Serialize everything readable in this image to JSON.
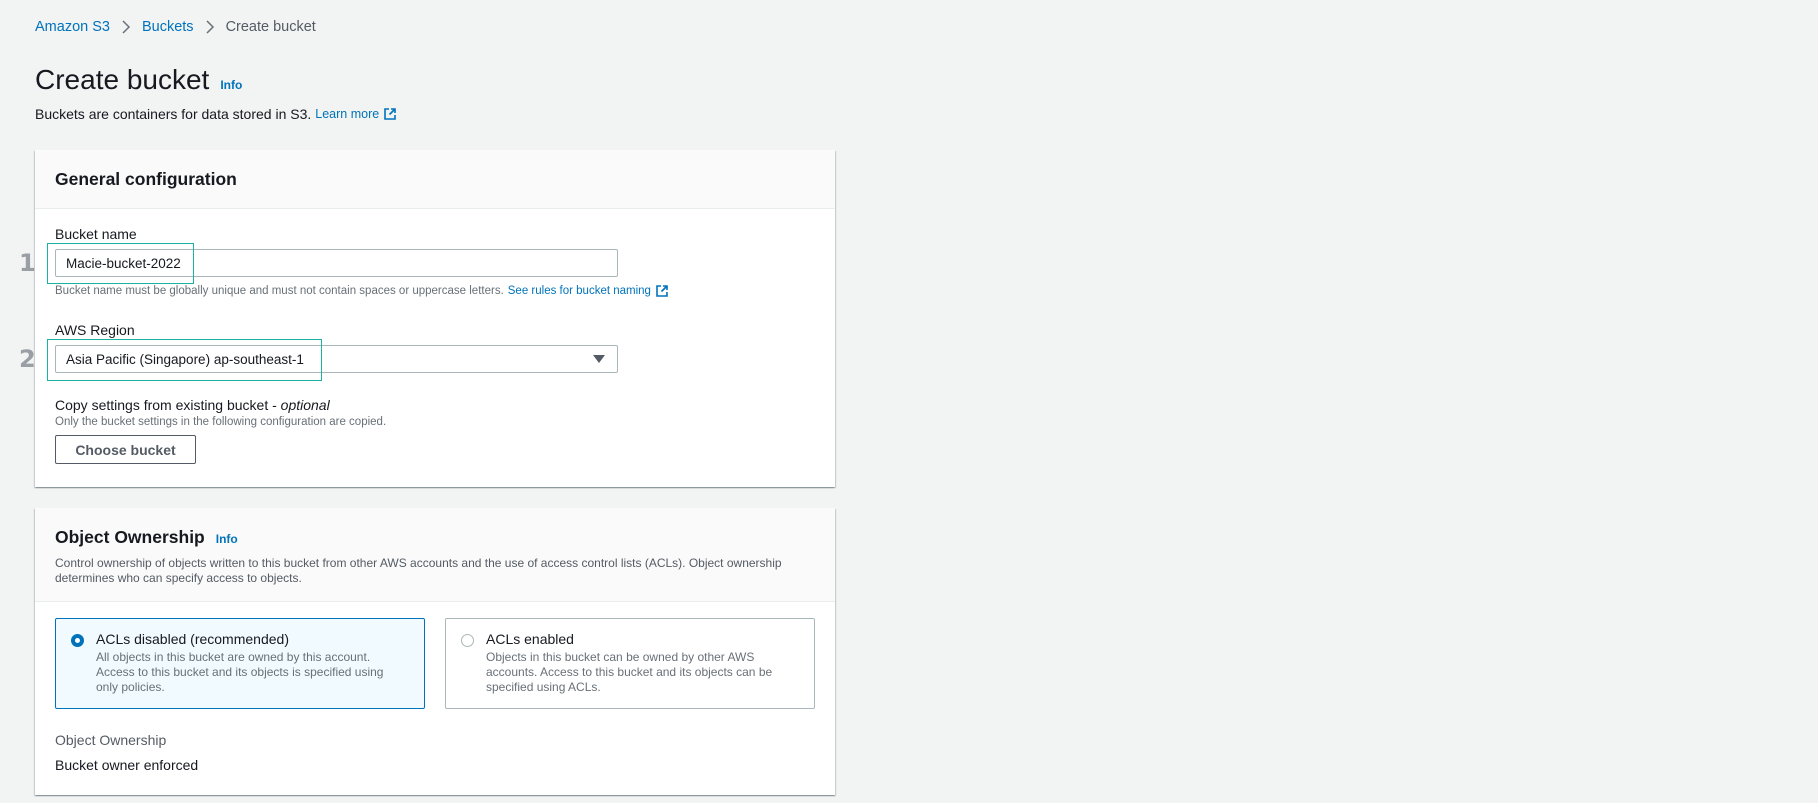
{
  "breadcrumb": {
    "items": [
      "Amazon S3",
      "Buckets"
    ],
    "current": "Create bucket"
  },
  "page": {
    "title": "Create bucket",
    "info": "Info",
    "description": "Buckets are containers for data stored in S3.",
    "learn_more": "Learn more"
  },
  "general_config": {
    "title": "General configuration",
    "bucket_name": {
      "label": "Bucket name",
      "value": "Macie-bucket-2022",
      "hint": "Bucket name must be globally unique and must not contain spaces or uppercase letters.",
      "hint_link": "See rules for bucket naming"
    },
    "region": {
      "label": "AWS Region",
      "value": "Asia Pacific (Singapore) ap-southeast-1"
    },
    "copy_settings": {
      "label": "Copy settings from existing bucket - ",
      "label_optional": "optional",
      "hint": "Only the bucket settings in the following configuration are copied.",
      "button": "Choose bucket"
    }
  },
  "annotations": {
    "step1": "1",
    "step2": "2",
    "highlight_color": "#1ab39d"
  },
  "object_ownership": {
    "title": "Object Ownership",
    "info": "Info",
    "description": "Control ownership of objects written to this bucket from other AWS accounts and the use of access control lists (ACLs). Object ownership determines who can specify access to objects.",
    "options": [
      {
        "label": "ACLs disabled (recommended)",
        "description": "All objects in this bucket are owned by this account. Access to this bucket and its objects is specified using only policies.",
        "selected": true
      },
      {
        "label": "ACLs enabled",
        "description": "Objects in this bucket can be owned by other AWS accounts. Access to this bucket and its objects can be specified using ACLs.",
        "selected": false
      }
    ],
    "setting_label": "Object Ownership",
    "setting_value": "Bucket owner enforced"
  },
  "colors": {
    "link": "#0073bb",
    "background": "#f2f3f3",
    "text": "#16191f"
  }
}
